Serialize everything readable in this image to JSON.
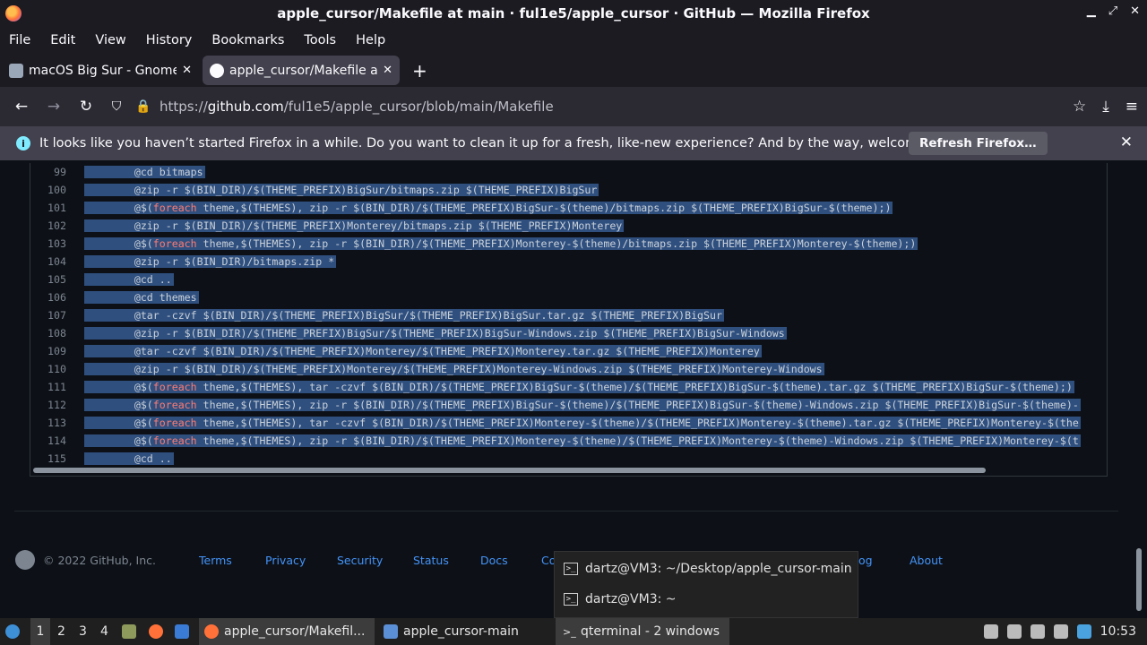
{
  "window": {
    "title": "apple_cursor/Makefile at main · ful1e5/apple_cursor · GitHub — Mozilla Firefox",
    "minimize": "▁",
    "restore": "⤢",
    "close": "✕"
  },
  "menu": [
    "File",
    "Edit",
    "View",
    "History",
    "Bookmarks",
    "Tools",
    "Help"
  ],
  "tabs": [
    {
      "label": "macOS Big Sur - Gnome-",
      "active": false,
      "close": "✕"
    },
    {
      "label": "apple_cursor/Makefile at",
      "active": true,
      "close": "✕"
    }
  ],
  "newtab": "+",
  "nav": {
    "back": "←",
    "forward": "→",
    "reload": "↻",
    "shield": "⛉",
    "lock": "🔒",
    "url_prefix": "https://",
    "url_host": "github.com",
    "url_path": "/ful1e5/apple_cursor/blob/main/Makefile",
    "bookmark": "☆",
    "download": "⤓",
    "menu": "≡"
  },
  "notification": {
    "icon": "i",
    "text": "It looks like you haven’t started Firefox in a while. Do you want to clean it up for a fresh, like-new experience? And by the way, welcome back!",
    "button": "Refresh Firefox…",
    "close": "✕"
  },
  "code_lines": [
    {
      "n": "99",
      "text": "        @cd bitmaps"
    },
    {
      "n": "100",
      "text": "        @zip -r $(BIN_DIR)/$(THEME_PREFIX)BigSur/bitmaps.zip $(THEME_PREFIX)BigSur"
    },
    {
      "n": "101",
      "pre": "        @$(",
      "kw": "foreach",
      "post": " theme,$(THEMES), zip -r $(BIN_DIR)/$(THEME_PREFIX)BigSur-$(theme)/bitmaps.zip $(THEME_PREFIX)BigSur-$(theme);)"
    },
    {
      "n": "102",
      "text": "        @zip -r $(BIN_DIR)/$(THEME_PREFIX)Monterey/bitmaps.zip $(THEME_PREFIX)Monterey"
    },
    {
      "n": "103",
      "pre": "        @$(",
      "kw": "foreach",
      "post": " theme,$(THEMES), zip -r $(BIN_DIR)/$(THEME_PREFIX)Monterey-$(theme)/bitmaps.zip $(THEME_PREFIX)Monterey-$(theme);)"
    },
    {
      "n": "104",
      "text": "        @zip -r $(BIN_DIR)/bitmaps.zip *"
    },
    {
      "n": "105",
      "text": "        @cd .."
    },
    {
      "n": "106",
      "text": "        @cd themes"
    },
    {
      "n": "107",
      "text": "        @tar -czvf $(BIN_DIR)/$(THEME_PREFIX)BigSur/$(THEME_PREFIX)BigSur.tar.gz $(THEME_PREFIX)BigSur"
    },
    {
      "n": "108",
      "text": "        @zip -r $(BIN_DIR)/$(THEME_PREFIX)BigSur/$(THEME_PREFIX)BigSur-Windows.zip $(THEME_PREFIX)BigSur-Windows"
    },
    {
      "n": "109",
      "text": "        @tar -czvf $(BIN_DIR)/$(THEME_PREFIX)Monterey/$(THEME_PREFIX)Monterey.tar.gz $(THEME_PREFIX)Monterey"
    },
    {
      "n": "110",
      "text": "        @zip -r $(BIN_DIR)/$(THEME_PREFIX)Monterey/$(THEME_PREFIX)Monterey-Windows.zip $(THEME_PREFIX)Monterey-Windows"
    },
    {
      "n": "111",
      "pre": "        @$(",
      "kw": "foreach",
      "post": " theme,$(THEMES), tar -czvf $(BIN_DIR)/$(THEME_PREFIX)BigSur-$(theme)/$(THEME_PREFIX)BigSur-$(theme).tar.gz $(THEME_PREFIX)BigSur-$(theme);)"
    },
    {
      "n": "112",
      "pre": "        @$(",
      "kw": "foreach",
      "post": " theme,$(THEMES), zip -r $(BIN_DIR)/$(THEME_PREFIX)BigSur-$(theme)/$(THEME_PREFIX)BigSur-$(theme)-Windows.zip $(THEME_PREFIX)BigSur-$(theme)-"
    },
    {
      "n": "113",
      "pre": "        @$(",
      "kw": "foreach",
      "post": " theme,$(THEMES), tar -czvf $(BIN_DIR)/$(THEME_PREFIX)Monterey-$(theme)/$(THEME_PREFIX)Monterey-$(theme).tar.gz $(THEME_PREFIX)Monterey-$(the"
    },
    {
      "n": "114",
      "pre": "        @$(",
      "kw": "foreach",
      "post": " theme,$(THEMES), zip -r $(BIN_DIR)/$(THEME_PREFIX)Monterey-$(theme)/$(THEME_PREFIX)Monterey-$(theme)-Windows.zip $(THEME_PREFIX)Monterey-$(t"
    },
    {
      "n": "115",
      "text": "        @cd .."
    }
  ],
  "footer": {
    "copyright": "© 2022 GitHub, Inc.",
    "links": [
      "Terms",
      "Privacy",
      "Security",
      "Status",
      "Docs",
      "Co",
      "og",
      "About"
    ]
  },
  "popup": {
    "items": [
      "dartz@VM3: ~/Desktop/apple_cursor-main",
      "dartz@VM3: ~"
    ],
    "term_glyph": ">_"
  },
  "taskbar": {
    "workspaces": [
      "1",
      "2",
      "3",
      "4"
    ],
    "windows": [
      "apple_cursor/Makefil...",
      "apple_cursor-main",
      "qterminal - 2 windows"
    ],
    "clock": "10:53"
  },
  "colors": {
    "selection": "#2f4f7f",
    "link": "#4493f8",
    "keyword": "#ff7b72"
  }
}
